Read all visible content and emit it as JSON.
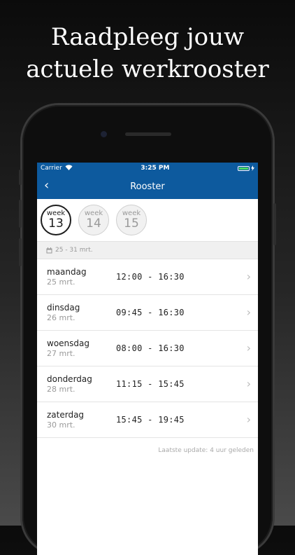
{
  "headline": {
    "line1": "Raadpleeg jouw",
    "line2": "actuele werkrooster"
  },
  "statusbar": {
    "carrier": "Carrier",
    "time": "3:25 PM"
  },
  "navbar": {
    "back_icon": "‹",
    "title": "Rooster"
  },
  "weeks": [
    {
      "label": "week",
      "number": "13",
      "selected": true
    },
    {
      "label": "week",
      "number": "14",
      "selected": false
    },
    {
      "label": "week",
      "number": "15",
      "selected": false
    }
  ],
  "date_range": "25 - 31 mrt.",
  "schedule": [
    {
      "day": "maandag",
      "date": "25 mrt.",
      "time": "12:00 - 16:30"
    },
    {
      "day": "dinsdag",
      "date": "26 mrt.",
      "time": "09:45 - 16:30"
    },
    {
      "day": "woensdag",
      "date": "27 mrt.",
      "time": "08:00 - 16:30"
    },
    {
      "day": "donderdag",
      "date": "28 mrt.",
      "time": "11:15 - 15:45"
    },
    {
      "day": "zaterdag",
      "date": "30 mrt.",
      "time": "15:45 - 19:45"
    }
  ],
  "last_update": "Laatste update: 4 uur geleden",
  "colors": {
    "brand": "#0d5a9e",
    "battery": "#4cd964"
  }
}
